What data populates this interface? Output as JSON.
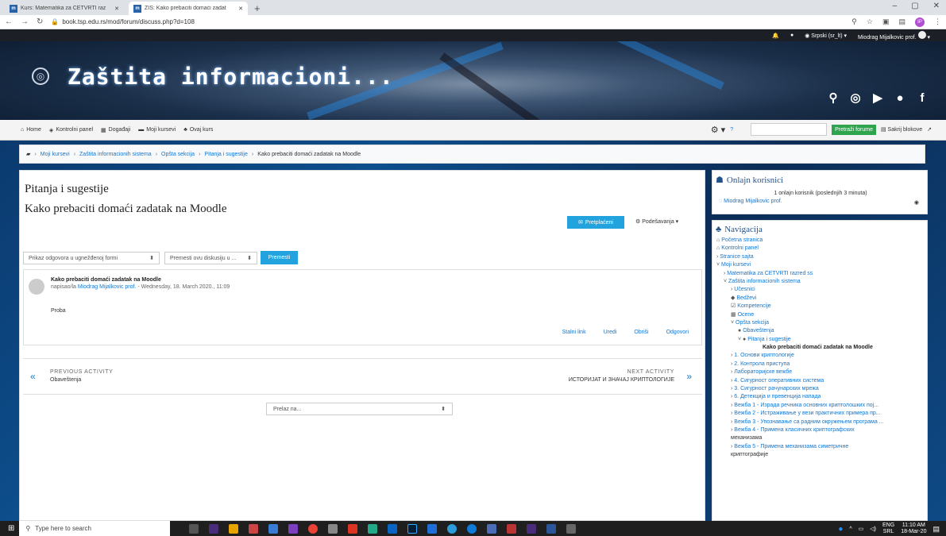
{
  "browser": {
    "tabs": [
      {
        "favicon": "m",
        "title": "Kurs: Matematika za ČETVRTI raz"
      },
      {
        "favicon": "m",
        "title": "ZIS: Kako prebaciti domaći zadat"
      }
    ],
    "new_tab": "+",
    "url": "book.tsp.edu.rs/mod/forum/discuss.php?d=108",
    "profile_initials": "IP",
    "window_controls": {
      "minimize": "–",
      "maximize": "▢",
      "close": "✕"
    }
  },
  "topbar": {
    "language": "Srpski (sr_lt)",
    "user": "Miodrag Mijalkovic prof."
  },
  "banner": {
    "site_name": "Zaštita informacioni..."
  },
  "navbar": {
    "items": [
      "Home",
      "Kontrolni panel",
      "Događaji",
      "Moji kursevi",
      "Ovaj kurs"
    ],
    "search_button": "Pretraži forume",
    "hide_blocks": "Sakrij blokove"
  },
  "breadcrumb": [
    "Moji kursevi",
    "Zaštita informacionih sistema",
    "Opšta sekcija",
    "Pitanja i sugestije",
    "Kako prebaciti domaći zadatak na Moodle"
  ],
  "forum": {
    "title": "Pitanja i sugestije",
    "discussion": "Kako prebaciti domaći zadatak na Moodle",
    "subscribed": "Pretplaćeni",
    "settings": "Podešavanja",
    "display_mode": "Prikaz odgovora u ugnežđenoj formi",
    "move_discussion": "Premesti ovu diskusiju u ...",
    "move_button": "Premesti",
    "post": {
      "title": "Kako prebaciti domaći zadatak na Moodle",
      "by_prefix": "napisao/la",
      "author": "Miodrag Mijalkovic prof.",
      "date": "- Wednesday, 18. March 2020., 11:09",
      "body": "Proba",
      "actions": [
        "Stalni link",
        "Uredi",
        "Obriši",
        "Odgovori"
      ]
    },
    "prev_label": "PREVIOUS ACTIVITY",
    "prev_name": "Obaveštenja",
    "next_label": "NEXT ACTIVITY",
    "next_name": "ИСТОРИЈАТ И ЗНАЧАЈ КРИПТОЛОГИЈЕ",
    "jump_to": "Prelaz na..."
  },
  "online_users": {
    "title": "Onlajn korisnici",
    "summary": "1 onlajn korisnik (poslednjih 3 minuta)",
    "user": "Miodrag Mijalkovic prof."
  },
  "navigation": {
    "title": "Navigacija",
    "items": [
      {
        "label": "Početna stranica",
        "depth": 0,
        "prefix": "⌂"
      },
      {
        "label": "Kontrolni panel",
        "depth": 0,
        "prefix": "⌂"
      },
      {
        "label": "Stranice sajta",
        "depth": 0,
        "prefix": "›"
      },
      {
        "label": "Moji kursevi",
        "depth": 0,
        "prefix": "˅"
      },
      {
        "label": "Matematika za ČETVRTI razred ss",
        "depth": 1,
        "prefix": "›"
      },
      {
        "label": "Zaštita informacionih sistema",
        "depth": 1,
        "prefix": "˅"
      },
      {
        "label": "Učesnici",
        "depth": 2,
        "prefix": "›"
      },
      {
        "label": "Bedževi",
        "depth": 2,
        "prefix": "◆"
      },
      {
        "label": "Kompetencije",
        "depth": 2,
        "prefix": "☑"
      },
      {
        "label": "Ocene",
        "depth": 2,
        "prefix": "▦"
      },
      {
        "label": "Opšta sekcija",
        "depth": 2,
        "prefix": "˅"
      },
      {
        "label": "Obaveštenja",
        "depth": 3,
        "prefix": "●"
      },
      {
        "label": "Pitanja i sugestije",
        "depth": 3,
        "prefix": "˅ ●"
      },
      {
        "label": "Kako prebaciti domaći zadatak na Moodle",
        "depth": 4,
        "prefix": "",
        "current": true
      },
      {
        "label": "1. Основи криптологије",
        "depth": 2,
        "prefix": "›"
      },
      {
        "label": "2. Контрола приступа",
        "depth": 2,
        "prefix": "›"
      },
      {
        "label": "Лабораторијске вежбе",
        "depth": 2,
        "prefix": "›"
      },
      {
        "label": "4. Сигурност оперативних система",
        "depth": 2,
        "prefix": "›"
      },
      {
        "label": "3. Сигурност рачунарских мрежа",
        "depth": 2,
        "prefix": "›"
      },
      {
        "label": "6. Детекција и превенција напада",
        "depth": 2,
        "prefix": "›"
      },
      {
        "label": "Вежба 1 - Израда речника основних криптолошких пој...",
        "depth": 2,
        "prefix": "›"
      },
      {
        "label": "Вежба 2 - Истраживање у вези практичних примера пр...",
        "depth": 2,
        "prefix": "›"
      },
      {
        "label": "Вежба 3 - Упознавање са радним окружењем програма ...",
        "depth": 2,
        "prefix": "›"
      },
      {
        "label": "Вежба 4 - Примена класичних криптографских",
        "depth": 2,
        "prefix": "›"
      },
      {
        "label": "механизама",
        "depth": 2,
        "prefix": "",
        "dark": true
      },
      {
        "label": "Вежба 5 - Примена механизама симетричне",
        "depth": 2,
        "prefix": "›"
      },
      {
        "label": "криптографије",
        "depth": 2,
        "prefix": "",
        "dark": true
      }
    ]
  },
  "taskbar": {
    "search_placeholder": "Type here to search",
    "lang": "ENG",
    "lang_sub": "SRL",
    "time": "11:10 AM",
    "date": "18-Mar-20"
  }
}
